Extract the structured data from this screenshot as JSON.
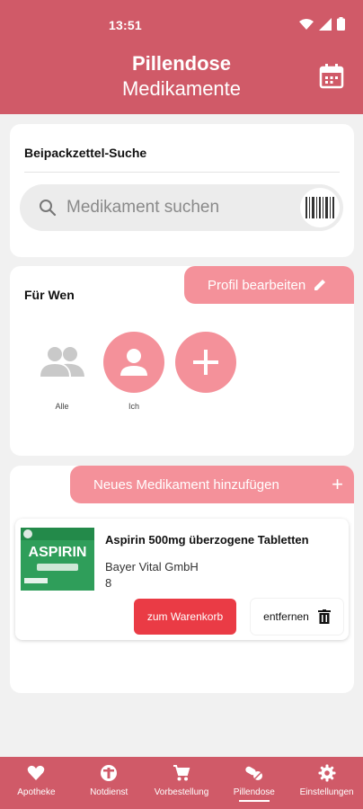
{
  "status_bar": {
    "time": "13:51"
  },
  "header": {
    "title": "Pillendose",
    "subtitle": "Medikamente",
    "calendar_icon": "calendar-icon"
  },
  "search_card": {
    "title": "Beipackzettel-Suche",
    "placeholder": "Medikament suchen",
    "value": ""
  },
  "who_card": {
    "title": "Für Wen",
    "edit_label": "Profil bearbeiten",
    "profiles": [
      {
        "label": "Alle",
        "icon": "group-icon"
      },
      {
        "label": "Ich",
        "icon": "person-icon"
      }
    ]
  },
  "meds_card": {
    "add_label": "Neues Medikament hinzufügen",
    "add_symbol": "+",
    "items": [
      {
        "name": "Aspirin 500mg überzogene Tabletten",
        "manufacturer": "Bayer Vital GmbH",
        "quantity": "8",
        "cart_label": "zum Warenkorb",
        "remove_label": "entfernen",
        "image_brand": "ASPIRIN"
      }
    ]
  },
  "bottom_nav": {
    "items": [
      {
        "label": "Apotheke",
        "icon": "heart-icon"
      },
      {
        "label": "Notdienst",
        "icon": "first-aid-icon"
      },
      {
        "label": "Vorbestellung",
        "icon": "cart-icon"
      },
      {
        "label": "Pillendose",
        "icon": "pills-icon",
        "active": true
      },
      {
        "label": "Einstellungen",
        "icon": "gear-icon"
      }
    ]
  },
  "colors": {
    "primary": "#d05a68",
    "accent_pink": "#f4919a",
    "cart_red": "#ea3b45",
    "background": "#f1f1f1"
  }
}
